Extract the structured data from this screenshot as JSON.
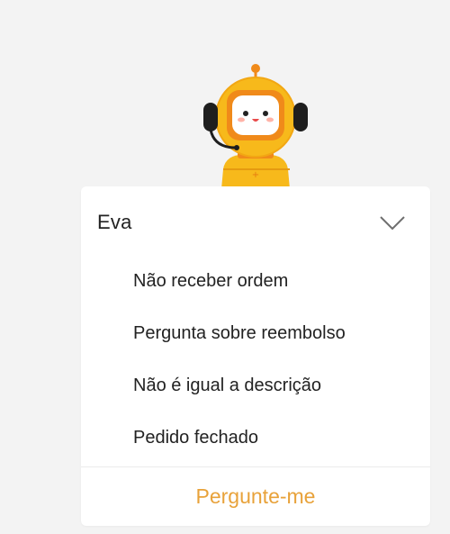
{
  "assistant": {
    "name": "Eva",
    "avatar_icon": "robot-assistant-icon",
    "toggle_icon": "chevron-down-icon"
  },
  "menu": {
    "items": [
      {
        "label": "Não receber ordem"
      },
      {
        "label": "Pergunta sobre reembolso"
      },
      {
        "label": "Não é igual a descrição"
      },
      {
        "label": "Pedido fechado"
      }
    ]
  },
  "footer": {
    "ask_label": "Pergunte-me"
  },
  "colors": {
    "accent": "#e8a23a",
    "robot_body": "#f7b91b",
    "robot_face": "#f08a1a",
    "background": "#f3f3f3"
  }
}
